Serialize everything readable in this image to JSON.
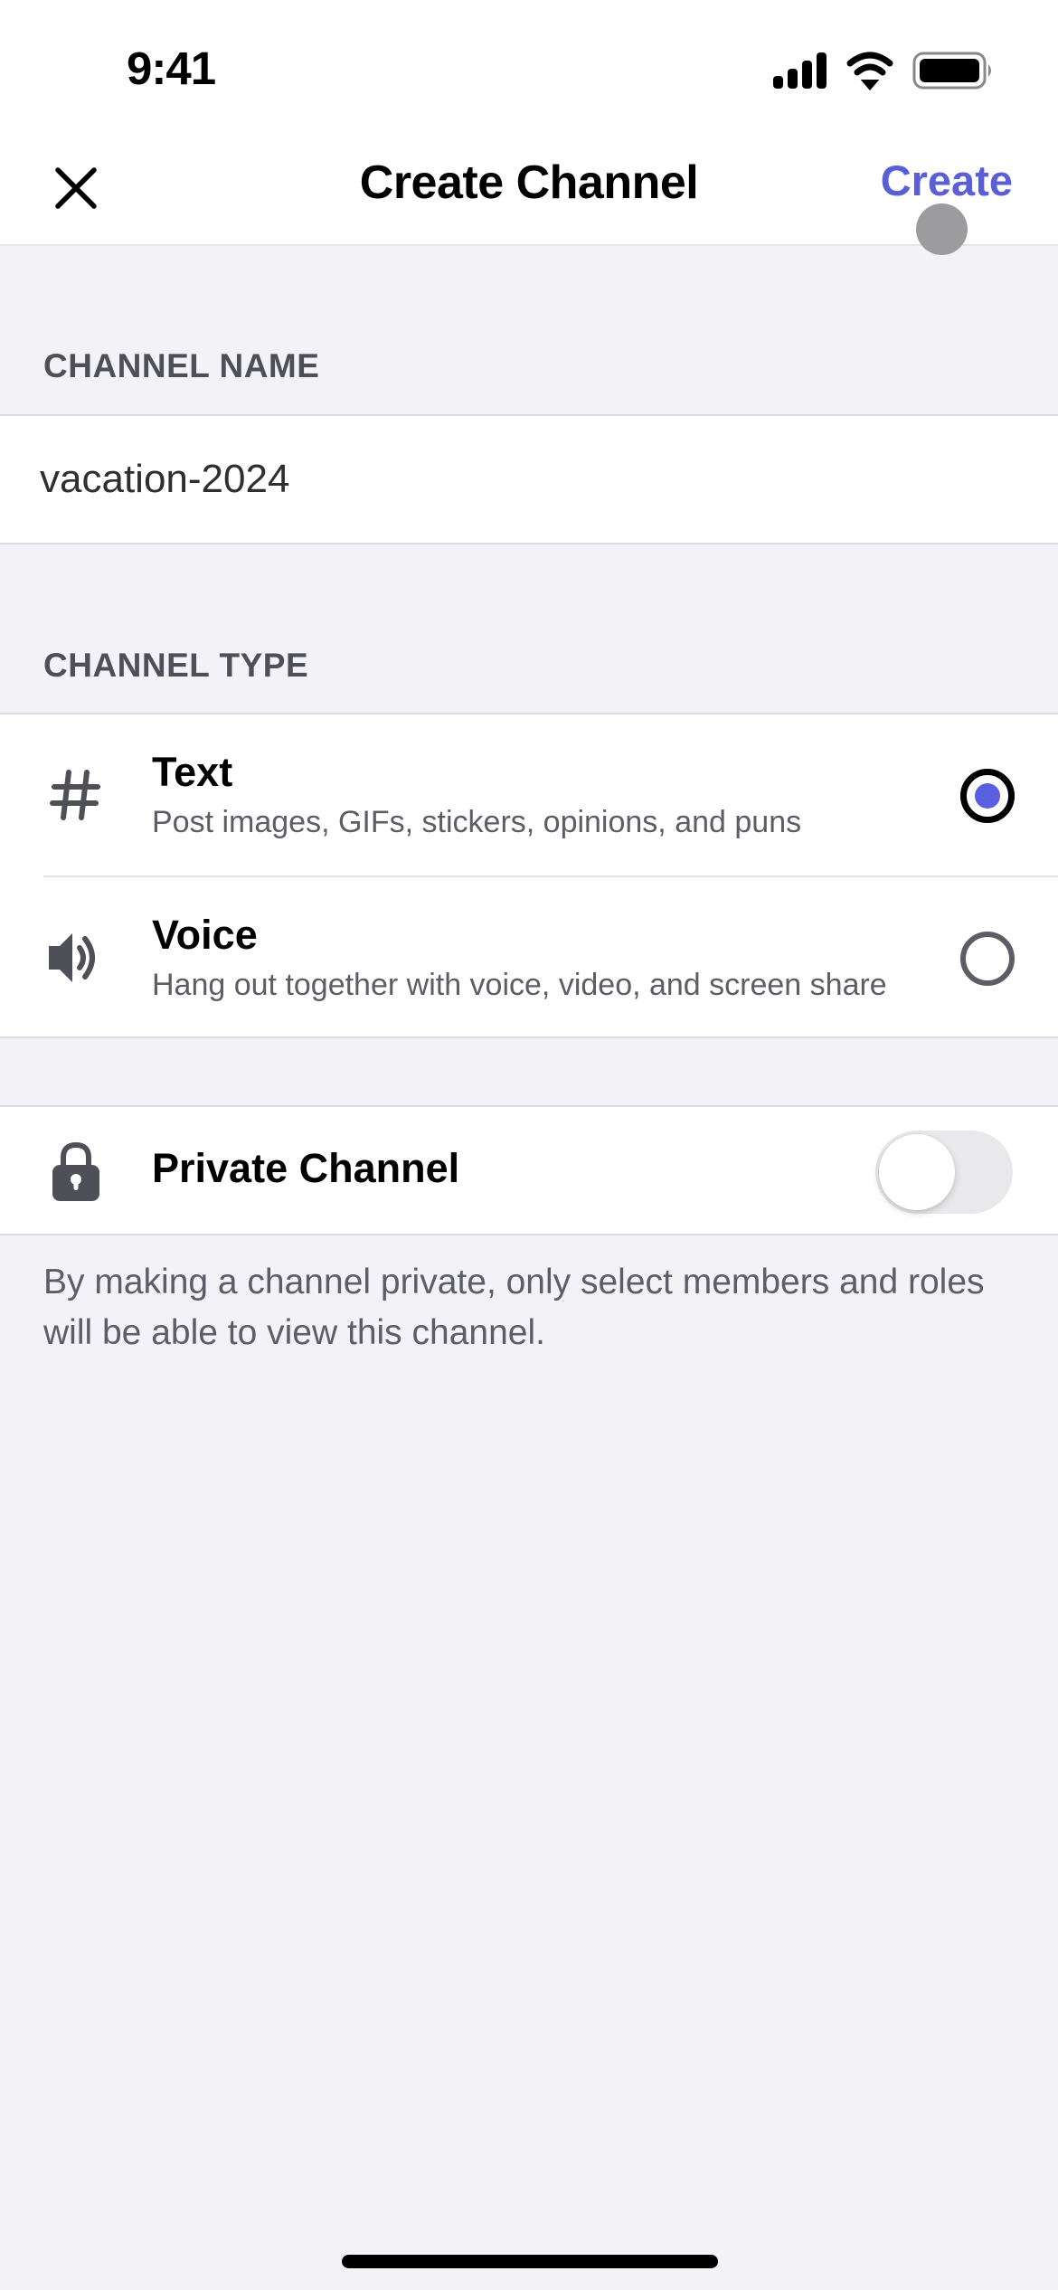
{
  "status_bar": {
    "time": "9:41",
    "icons": [
      "cellular-signal-icon",
      "wifi-icon",
      "battery-icon"
    ]
  },
  "nav": {
    "title": "Create Channel",
    "close_icon": "close-icon",
    "create_label": "Create"
  },
  "channel_name": {
    "label": "CHANNEL NAME",
    "value": "vacation-2024",
    "placeholder": ""
  },
  "channel_type": {
    "label": "CHANNEL TYPE",
    "options": [
      {
        "icon": "hash-icon",
        "title": "Text",
        "description": "Post images, GIFs, stickers, opinions, and puns",
        "selected": true
      },
      {
        "icon": "speaker-icon",
        "title": "Voice",
        "description": "Hang out together with voice, video, and screen share",
        "selected": false
      }
    ]
  },
  "private_channel": {
    "icon": "lock-icon",
    "label": "Private Channel",
    "enabled": false,
    "note": "By making a channel private, only select members and roles will be able to view this channel."
  },
  "colors": {
    "accent": "#5a5fd6",
    "radio_fill": "#5a5fe0",
    "background": "#f2f2f7",
    "secondary_text": "#5d5d65"
  }
}
